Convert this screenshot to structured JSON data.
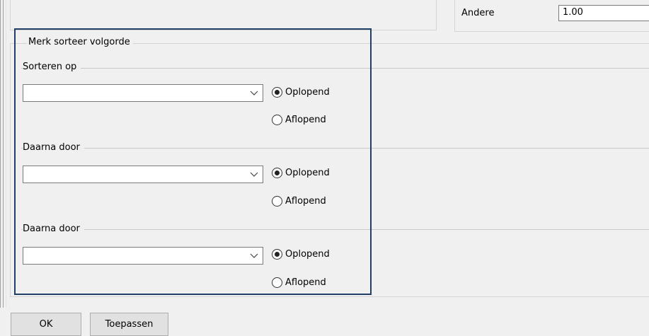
{
  "top_panel": {
    "andere_label": "Andere",
    "andere_value": "1.00"
  },
  "sort_group": {
    "title": "Merk sorteer volgorde",
    "sections": [
      {
        "label": "Sorteren op",
        "combo_value": "",
        "ascending_label": "Oplopend",
        "descending_label": "Aflopend",
        "selected": "ascending"
      },
      {
        "label": "Daarna door",
        "combo_value": "",
        "ascending_label": "Oplopend",
        "descending_label": "Aflopend",
        "selected": "ascending"
      },
      {
        "label": "Daarna door",
        "combo_value": "",
        "ascending_label": "Oplopend",
        "descending_label": "Aflopend",
        "selected": "ascending"
      }
    ]
  },
  "buttons": {
    "ok": "OK",
    "apply": "Toepassen"
  },
  "colors": {
    "highlight": "#1f3f66",
    "background": "#f0f0f0"
  }
}
